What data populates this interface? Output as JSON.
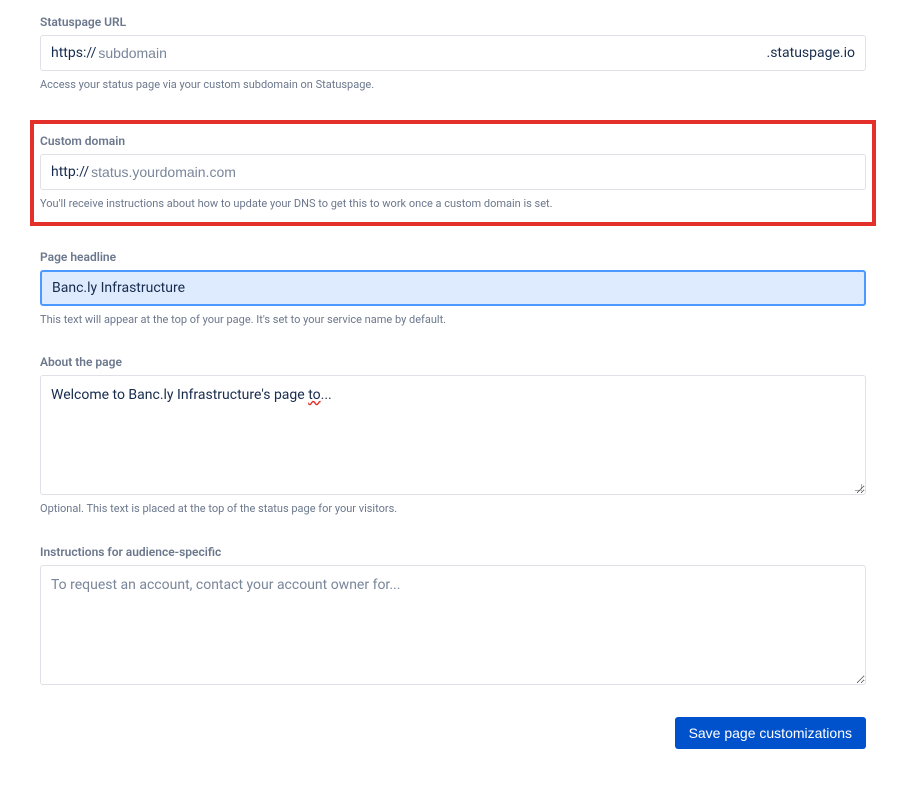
{
  "statuspage_url": {
    "label": "Statuspage URL",
    "prefix": "https://",
    "placeholder": "subdomain",
    "value": "",
    "suffix": ".statuspage.io",
    "help": "Access your status page via your custom subdomain on Statuspage."
  },
  "custom_domain": {
    "label": "Custom domain",
    "prefix": "http://",
    "placeholder": "status.yourdomain.com",
    "value": "",
    "help": "You'll receive instructions about how to update your DNS to get this to work once a custom domain is set."
  },
  "page_headline": {
    "label": "Page headline",
    "value": "Banc.ly Infrastructure",
    "help": "This text will appear at the top of your page. It's set to your service name by default."
  },
  "about": {
    "label": "About the page",
    "value_prefix": "Welcome to Banc.ly Infrastructure's page ",
    "value_underlined": "to",
    "value_suffix": "...",
    "help": "Optional. This text is placed at the top of the status page for your visitors."
  },
  "instructions": {
    "label": "Instructions for audience-specific",
    "placeholder": "To request an account, contact your account owner for...",
    "value": ""
  },
  "footer": {
    "save_label": "Save page customizations"
  }
}
